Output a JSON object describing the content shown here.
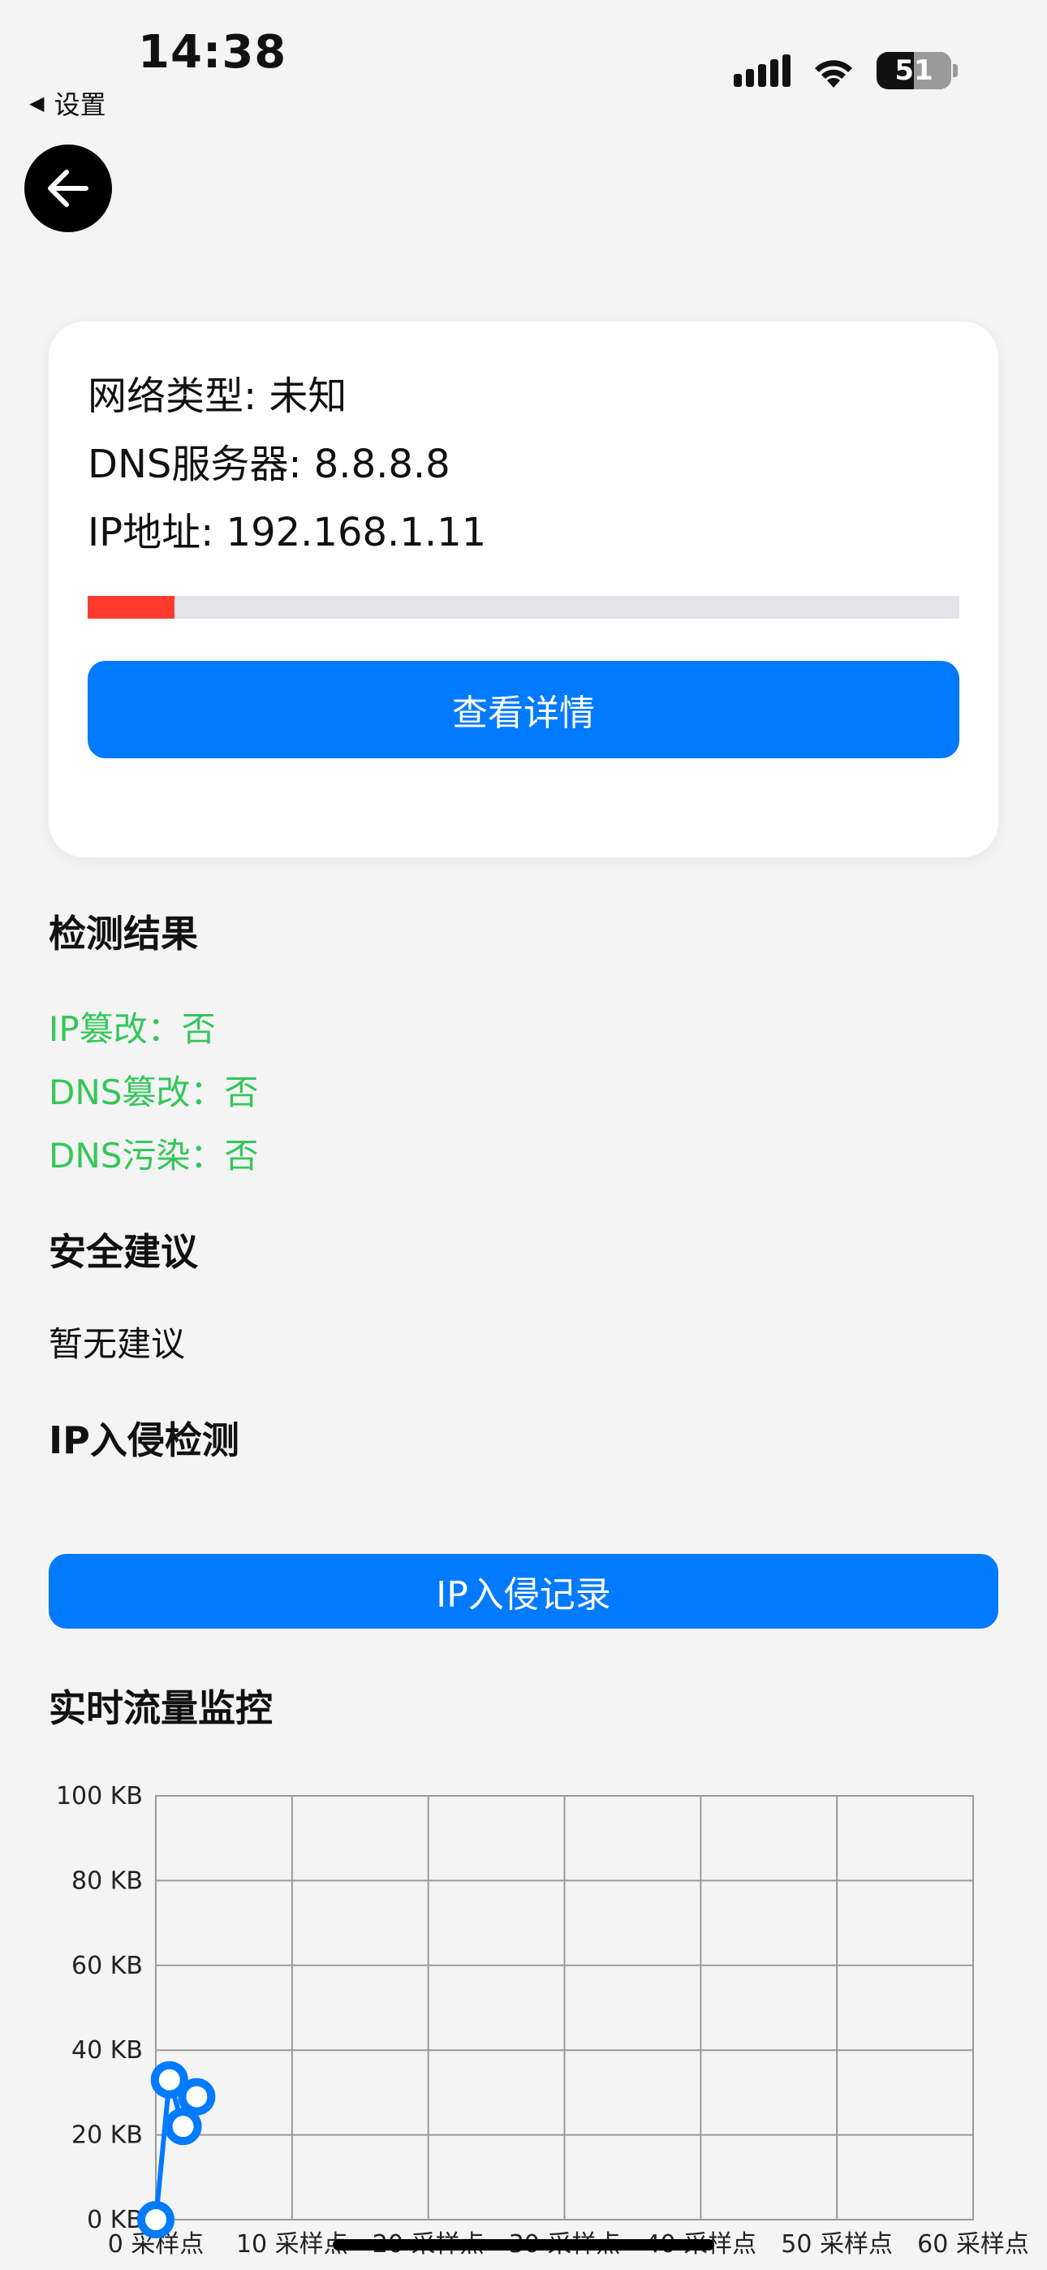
{
  "status_bar": {
    "time": "14:38",
    "back_label": "设置",
    "battery": "51"
  },
  "card": {
    "network_type": "网络类型: 未知",
    "dns_server": "DNS服务器: 8.8.8.8",
    "ip_address": "IP地址: 192.168.1.11",
    "progress_fraction": 0.1,
    "progress_color": "#ff3b30",
    "details_button": "查看详情"
  },
  "results": {
    "title": "检测结果",
    "ip_tamper": "IP篡改：否",
    "dns_tamper": "DNS篡改：否",
    "dns_pollution": "DNS污染：否",
    "color": "#34c759"
  },
  "advice": {
    "title": "安全建议",
    "text": "暂无建议"
  },
  "intrusion": {
    "title": "IP入侵检测",
    "button": "IP入侵记录"
  },
  "traffic": {
    "title": "实时流量监控"
  },
  "colors": {
    "accent": "#007aff",
    "background": "#f4f4f4"
  },
  "chart_data": {
    "type": "line",
    "title": "",
    "xlabel": "",
    "ylabel": "",
    "x_ticks": [
      "0 采样点",
      "10 采样点",
      "20 采样点",
      "30 采样点",
      "40 采样点",
      "50 采样点",
      "60 采样点"
    ],
    "y_ticks": [
      "0 KB",
      "20 KB",
      "40 KB",
      "60 KB",
      "80 KB",
      "100 KB"
    ],
    "xlim": [
      0,
      60
    ],
    "ylim": [
      0,
      100
    ],
    "grid": true,
    "series": [
      {
        "color": "#007aff",
        "points": [
          [
            0,
            0
          ],
          [
            1,
            33
          ],
          [
            2,
            22
          ],
          [
            3,
            29
          ]
        ]
      }
    ]
  }
}
